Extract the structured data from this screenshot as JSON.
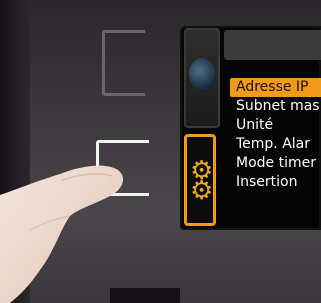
{
  "menu": {
    "items": [
      {
        "label": "Adresse IP",
        "selected": true
      },
      {
        "label": "Subnet mas",
        "selected": false
      },
      {
        "label": "Unité",
        "selected": false
      },
      {
        "label": "Temp. Alar",
        "selected": false
      },
      {
        "label": "Mode timer",
        "selected": false
      },
      {
        "label": "Insertion",
        "selected": false
      }
    ]
  },
  "colors": {
    "accent": "#f29a1c",
    "screen_bg": "#050505",
    "bezel": "#3a373a"
  },
  "icons": {
    "globe": "globe-icon",
    "gear": "gear-icon"
  }
}
